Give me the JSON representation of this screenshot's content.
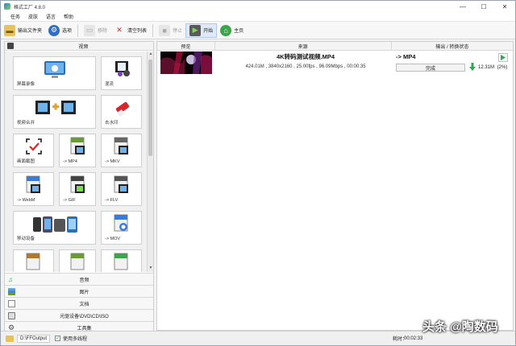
{
  "window": {
    "title": "格式工厂 4.8.0",
    "minimize": "—",
    "maximize": "☐",
    "close": "✕"
  },
  "menu": [
    "任务",
    "皮肤",
    "语言",
    "帮助"
  ],
  "toolbar": {
    "output_folder": "输出文件夹",
    "options": "选项",
    "remove": "移除",
    "clear_list": "清空列表",
    "stop": "停止",
    "start": "开始",
    "home": "主页"
  },
  "left_panel": {
    "header": "视频",
    "tiles": [
      {
        "label": "屏幕录像"
      },
      {
        "label": "混流"
      },
      {
        "label": "视频合并"
      },
      {
        "label": "去水印"
      },
      {
        "label": "画面截图"
      },
      {
        "label": "-> MP4",
        "badge": "MP4"
      },
      {
        "label": "-> MKV",
        "badge": "MKV"
      },
      {
        "label": "-> WebM",
        "badge": "WebM"
      },
      {
        "label": "-> GIF",
        "badge": "GIF"
      },
      {
        "label": "-> FLV",
        "badge": "FLV"
      },
      {
        "label": "移动设备"
      },
      {
        "label": "-> MOV",
        "badge": "MOV"
      }
    ],
    "categories": [
      "音频",
      "图片",
      "文档",
      "光驱设备\\DVD\\CD\\ISO",
      "工具集"
    ]
  },
  "right_panel": {
    "columns": {
      "preview": "预览",
      "source": "来源",
      "output": "输出 / 转换状态"
    },
    "task": {
      "filename": "4K转码测试视频.MP4",
      "info": "424.01M , 3840x2160 , 25.00fps , 96.09Mbps , 00:00:35",
      "format": "-> MP4",
      "status": "完成",
      "output_size": "12.31M",
      "ratio": "(2%)"
    }
  },
  "statusbar": {
    "output_path": "D:\\FFOutput",
    "multithread_label": "使用多线程",
    "multithread_checked": "✓",
    "elapsed_label": "耗时：",
    "elapsed": "00:02:33"
  },
  "watermark": "头条 @陶数码",
  "colors": {
    "accent_green": "#2fa84f",
    "tile_border": "#cfcfcf",
    "selection": "#dfe9f7"
  }
}
